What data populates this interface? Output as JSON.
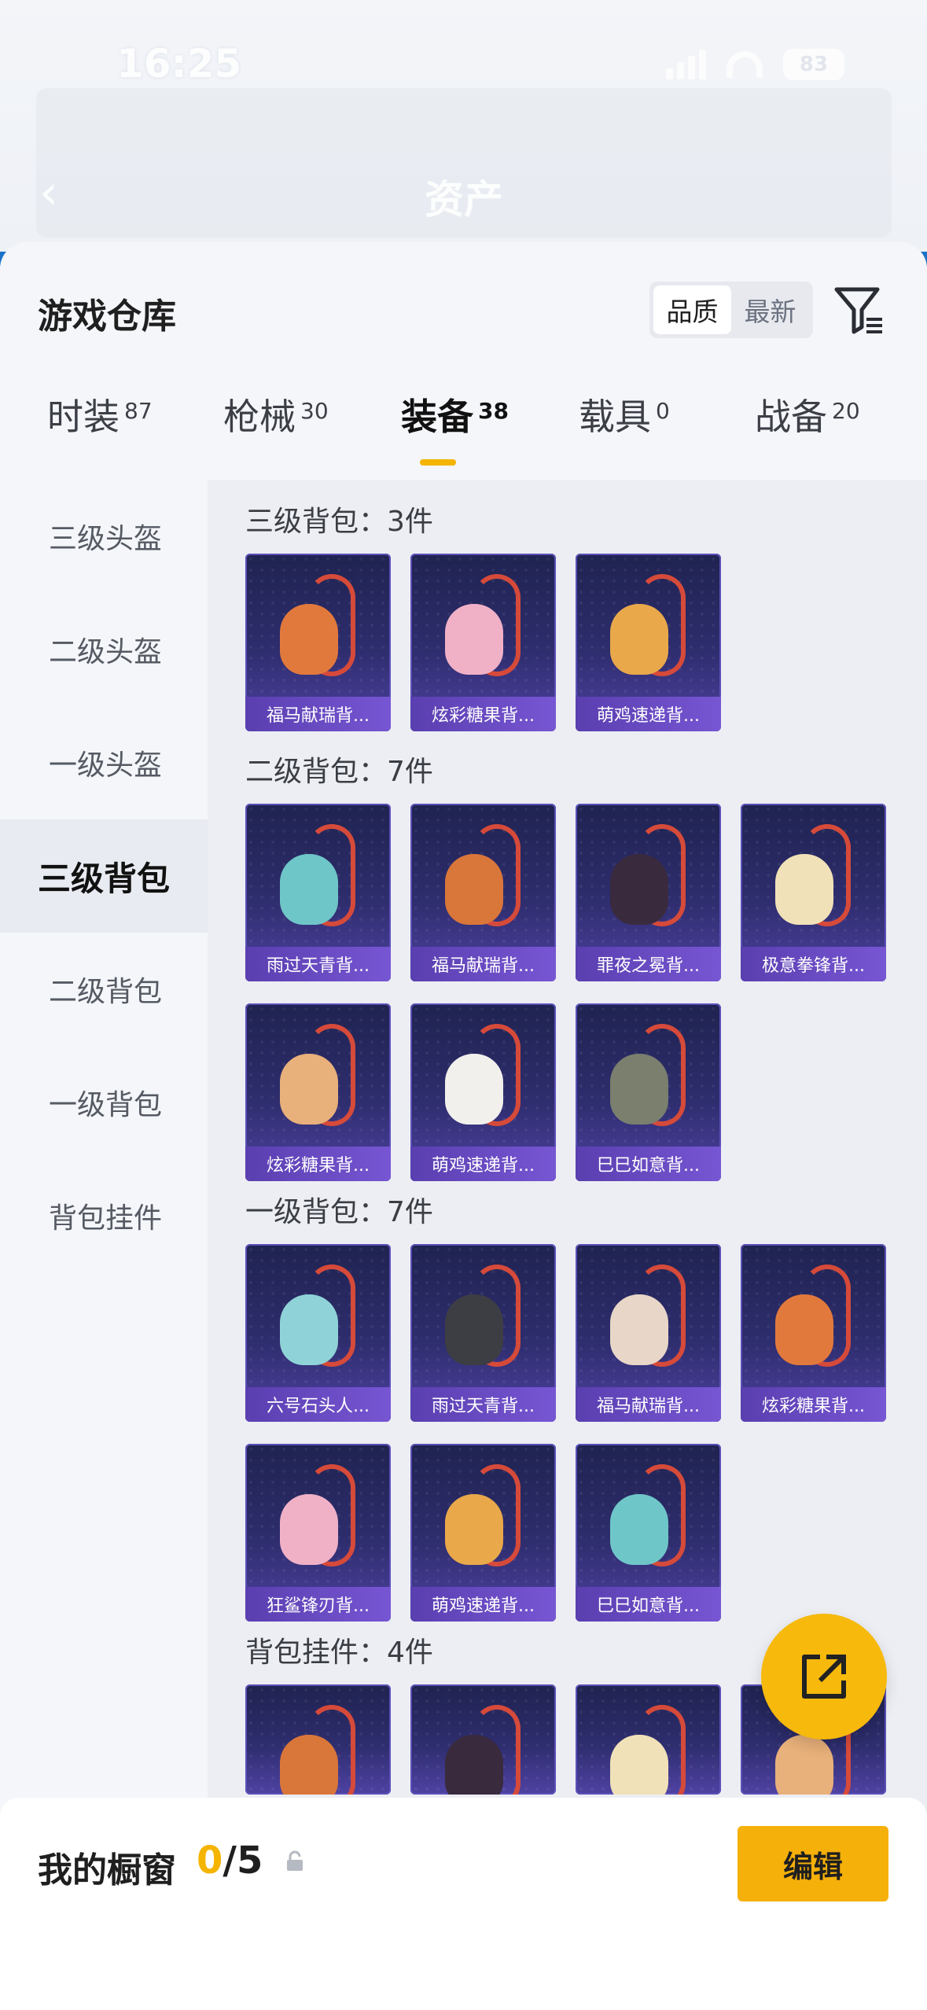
{
  "status_bar": {
    "time": "16:25",
    "battery": "83"
  },
  "background_page": {
    "title": "资产"
  },
  "sheet": {
    "title": "游戏仓库",
    "sort_options": [
      "品质",
      "最新"
    ],
    "sort_active": "品质"
  },
  "category_tabs": [
    {
      "label": "时装",
      "count": "87"
    },
    {
      "label": "枪械",
      "count": "30"
    },
    {
      "label": "装备",
      "count": "38",
      "active": true
    },
    {
      "label": "载具",
      "count": "0"
    },
    {
      "label": "战备",
      "count": "20"
    }
  ],
  "sidebar": {
    "items": [
      "三级头盔",
      "二级头盔",
      "一级头盔",
      "三级背包",
      "二级背包",
      "一级背包",
      "背包挂件"
    ],
    "active": "三级背包"
  },
  "groups": [
    {
      "title": "三级背包：3件",
      "items": [
        "福马献瑞背...",
        "炫彩糖果背...",
        "萌鸡速递背..."
      ]
    },
    {
      "title": "二级背包：7件",
      "items": [
        "雨过天青背...",
        "福马献瑞背...",
        "罪夜之冕背...",
        "极意拳锋背...",
        "炫彩糖果背...",
        "萌鸡速递背...",
        "巳巳如意背..."
      ]
    },
    {
      "title": "一级背包：7件",
      "items": [
        "六号石头人...",
        "雨过天青背...",
        "福马献瑞背...",
        "炫彩糖果背...",
        "狂鲨锋刃背...",
        "萌鸡速递背...",
        "巳巳如意背..."
      ]
    },
    {
      "title": "背包挂件：4件",
      "items": [
        "",
        "",
        "",
        ""
      ]
    }
  ],
  "bottom_bar": {
    "label": "我的橱窗",
    "current": "0",
    "total": "/5",
    "edit_label": "编辑"
  },
  "icons": [
    "back-icon",
    "filter-icon",
    "share-icon",
    "lock-icon"
  ],
  "colors": {
    "accent": "#f6b00a",
    "card_label": "#6a4bc4"
  }
}
